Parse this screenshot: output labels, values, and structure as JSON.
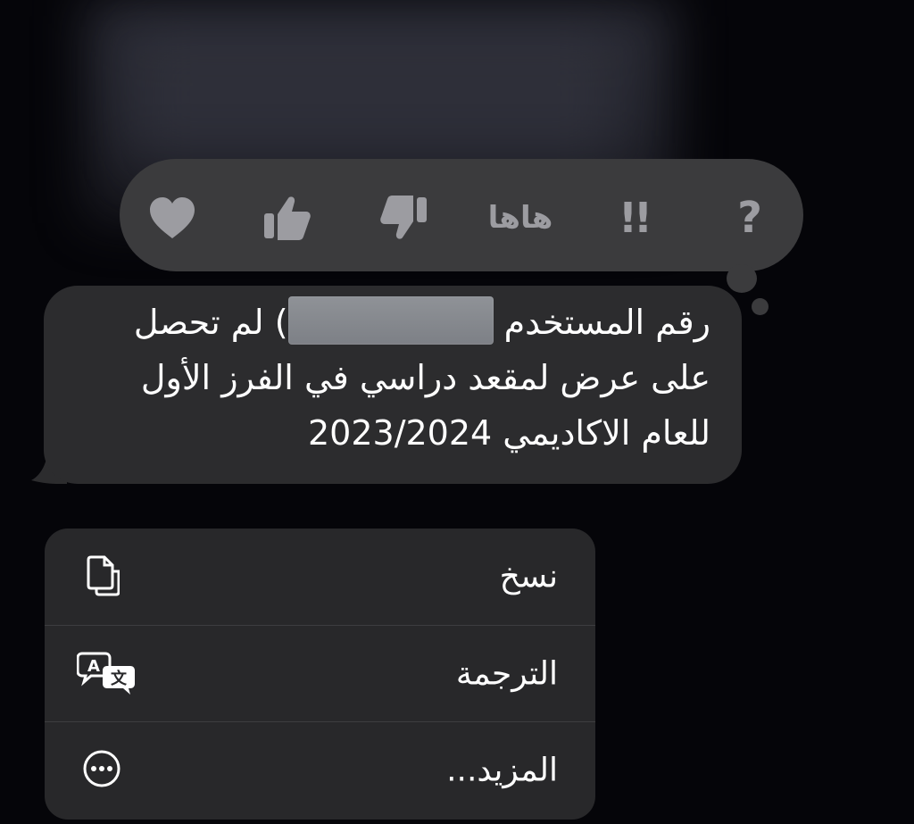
{
  "reactions": [
    {
      "icon": "heart-icon"
    },
    {
      "icon": "thumbs-up-icon"
    },
    {
      "icon": "thumbs-down-icon"
    },
    {
      "icon": "haha-icon",
      "label": "هاها"
    },
    {
      "icon": "exclamation-icon",
      "label": "!!"
    },
    {
      "icon": "question-icon",
      "label": "?"
    }
  ],
  "message": {
    "line1_start": "رقم المستخدم",
    "line1_end": ") لم تحصل",
    "line2": "على عرض لمقعد دراسي في الفرز الأول",
    "line3": "للعام الاكاديمي 2023/2024"
  },
  "menu": {
    "items": [
      {
        "label": "نسخ",
        "icon": "copy-icon"
      },
      {
        "label": "الترجمة",
        "icon": "translate-icon"
      },
      {
        "label": "المزيد...",
        "icon": "more-icon"
      }
    ]
  },
  "colors": {
    "background": "#050509",
    "bubble": "#2c2c2e",
    "reaction_bar": "#3b3b3d",
    "menu": "#28282a",
    "icon_gray": "#9c9ca1",
    "text": "#ffffff"
  }
}
